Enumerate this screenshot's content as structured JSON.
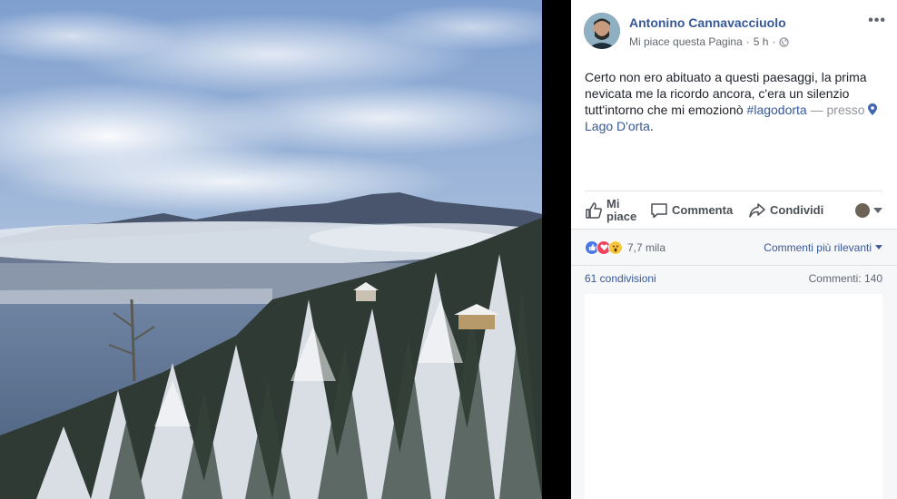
{
  "post": {
    "author": "Antonino Cannavacciuolo",
    "like_page": "Mi piace questa Pagina",
    "dot": "·",
    "time": "5 h",
    "dot2": "·",
    "more": "•••",
    "text_main": "Certo non ero abituato a questi paesaggi, la prima nevicata me la ricordo ancora, c'era un silenzio tutt'intorno che mi emozionò ",
    "hashtag": "#lagodorta",
    "separator": " — presso ",
    "place": "Lago D'orta",
    "period": "."
  },
  "actions": {
    "like_line1": "Mi",
    "like_line2": "piace",
    "comment": "Commenta",
    "share": "Condividi"
  },
  "reactions": {
    "count": "7,7 mila",
    "sort_label": "Commenti più rilevanti"
  },
  "stats": {
    "shares": "61 condivisioni",
    "comments": "Commenti: 140"
  },
  "colors": {
    "link": "#365899",
    "like": "#4a76e8",
    "love": "#f0425c",
    "wow": "#f7c63f"
  },
  "icons": [
    "globe-icon",
    "more-icon",
    "thumbs-up-icon",
    "comment-icon",
    "share-icon",
    "location-pin-icon",
    "chevron-down-icon"
  ]
}
